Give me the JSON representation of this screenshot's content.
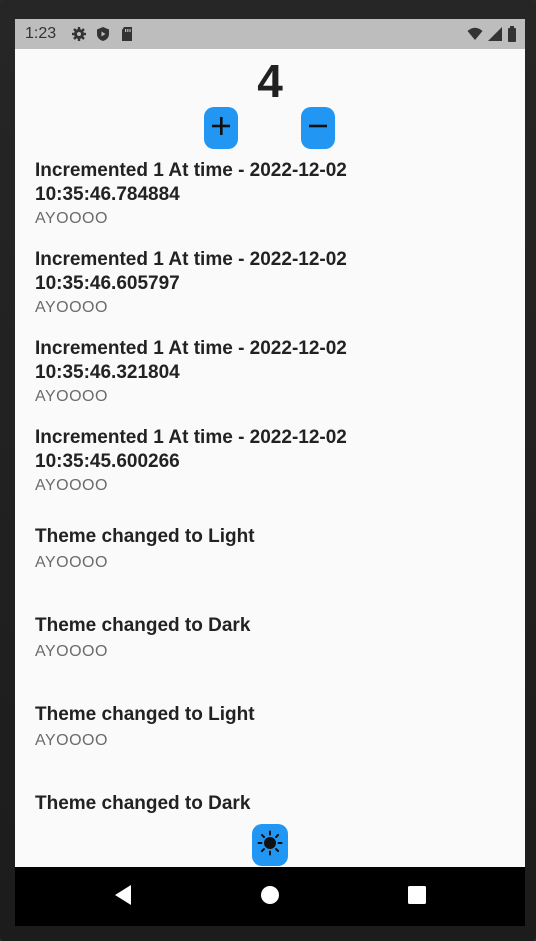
{
  "status_bar": {
    "time": "1:23",
    "left_icons": [
      "gear-icon",
      "shield-play-icon",
      "sd-card-icon"
    ],
    "right_icons": [
      "wifi-icon",
      "signal-icon",
      "battery-icon"
    ]
  },
  "counter": {
    "value": "4"
  },
  "controls": {
    "increment_icon": "plus-icon",
    "decrement_icon": "minus-icon",
    "theme_icon": "sun-icon",
    "accent": "#2196f3"
  },
  "log": [
    {
      "title_line1": "Incremented 1  At time - 2022-12-02",
      "title_line2": "10:35:46.784884",
      "subtitle": "AYOOOO"
    },
    {
      "title_line1": "Incremented 1  At time - 2022-12-02",
      "title_line2": "10:35:46.605797",
      "subtitle": "AYOOOO"
    },
    {
      "title_line1": "Incremented 1  At time - 2022-12-02",
      "title_line2": "10:35:46.321804",
      "subtitle": "AYOOOO"
    },
    {
      "title_line1": "Incremented 1  At time - 2022-12-02",
      "title_line2": "10:35:45.600266",
      "subtitle": "AYOOOO"
    },
    {
      "title_line1": "Theme changed to Light",
      "subtitle": "AYOOOO"
    },
    {
      "title_line1": "Theme changed to Dark",
      "subtitle": "AYOOOO"
    },
    {
      "title_line1": "Theme changed to Light",
      "subtitle": "AYOOOO"
    },
    {
      "title_line1": "Theme changed to Dark"
    }
  ],
  "nav_bar": {
    "back_icon": "back-triangle-icon",
    "home_icon": "home-circle-icon",
    "recents_icon": "recents-square-icon"
  }
}
